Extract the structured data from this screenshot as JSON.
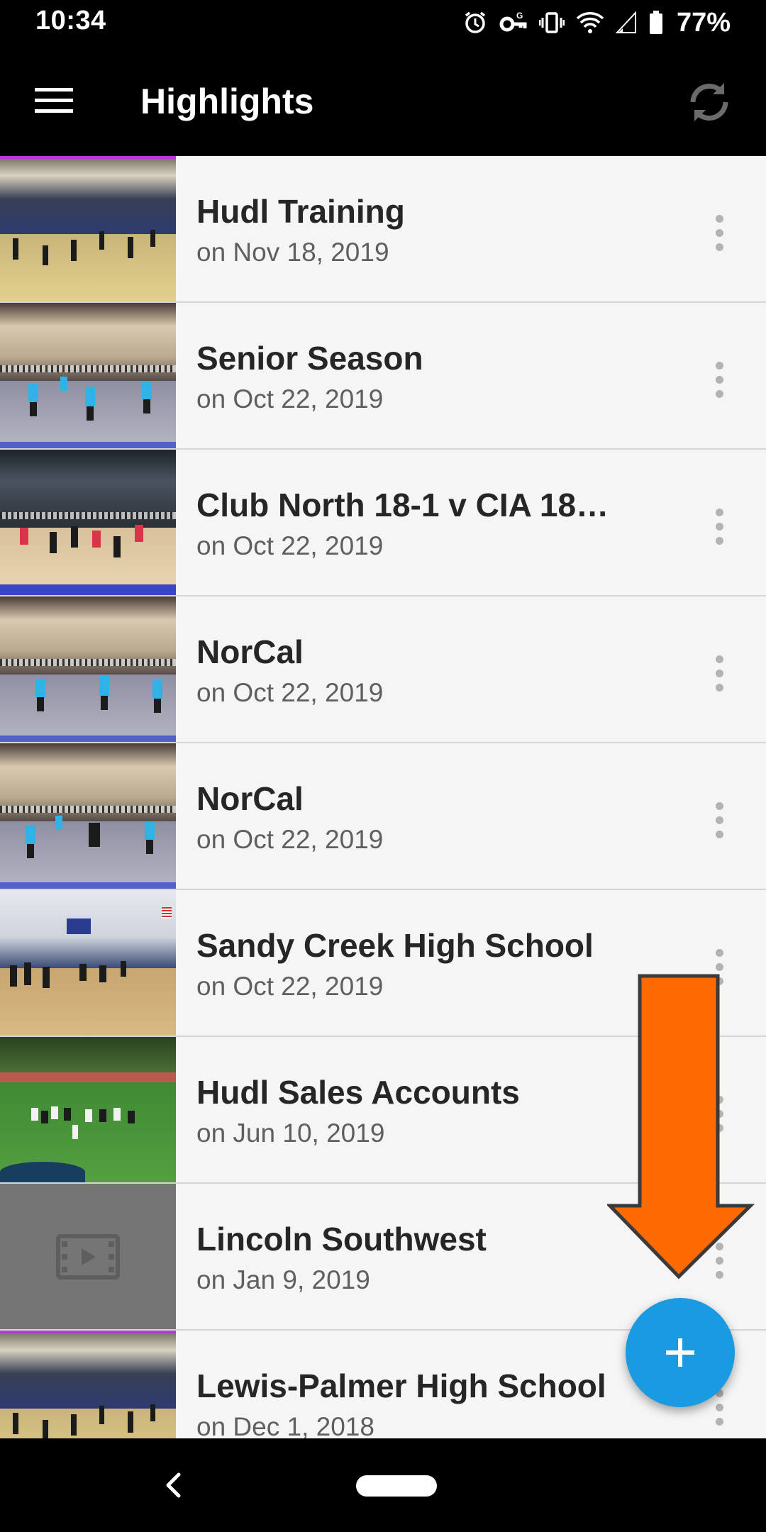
{
  "status_bar": {
    "time": "10:34",
    "battery": "77%",
    "icons": [
      "alarm-icon",
      "vpn-key-icon",
      "vibrate-icon",
      "wifi-icon",
      "signal-icon",
      "battery-icon"
    ]
  },
  "app_bar": {
    "title": "Highlights",
    "menu_icon": "menu-icon",
    "action_icon": "sync-icon"
  },
  "highlights": [
    {
      "title": "Hudl Training",
      "date": "on Nov 18, 2019",
      "thumbnail": "volleyball-gym-bleachers"
    },
    {
      "title": "Senior Season",
      "date": "on Oct 22, 2019",
      "thumbnail": "volleyball-court-blue"
    },
    {
      "title": "Club North 18-1 v CIA 18…",
      "date": "on Oct 22, 2019",
      "thumbnail": "volleyball-court-red"
    },
    {
      "title": "NorCal",
      "date": "on Oct 22, 2019",
      "thumbnail": "volleyball-court-blue"
    },
    {
      "title": "NorCal",
      "date": "on Oct 22, 2019",
      "thumbnail": "volleyball-court-blue"
    },
    {
      "title": "Sandy Creek High School",
      "date": "on Oct 22, 2019",
      "thumbnail": "school-gym"
    },
    {
      "title": "Hudl Sales Accounts",
      "date": "on Jun 10, 2019",
      "thumbnail": "football-field"
    },
    {
      "title": "Lincoln Southwest",
      "date": "on Jan 9, 2019",
      "thumbnail": "video-placeholder"
    },
    {
      "title": "Lewis-Palmer High School",
      "date": "on Dec 1, 2018",
      "thumbnail": "volleyball-gym-bleachers"
    }
  ],
  "fab": {
    "icon": "plus-icon",
    "color": "#1a9ae0"
  },
  "annotation": {
    "icon": "orange-down-arrow-icon",
    "color": "#ff6a00"
  },
  "nav_bar": {
    "icons": [
      "back-icon",
      "home-pill-icon"
    ]
  },
  "colors": {
    "app_bar": "#000000",
    "list_background": "#f5f5f5",
    "divider": "#d6d6d6",
    "title_text": "#262626",
    "date_text": "#5f5f5f"
  }
}
